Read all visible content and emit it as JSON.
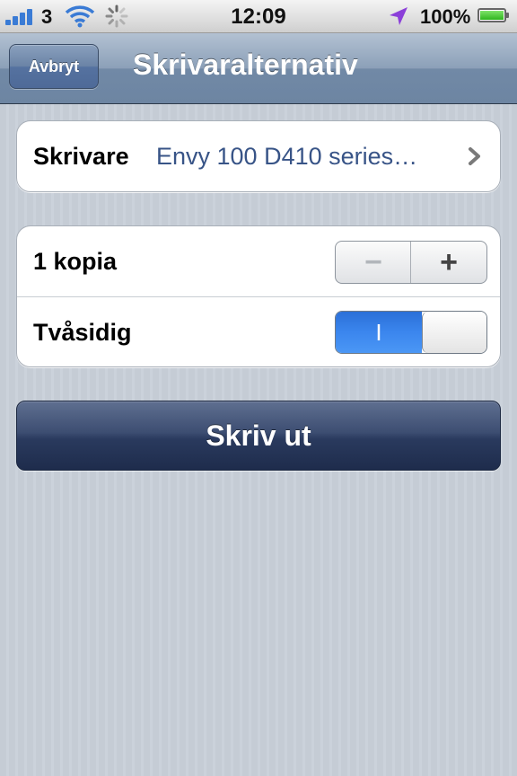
{
  "status_bar": {
    "carrier": "3",
    "time": "12:09",
    "battery": "100%",
    "battery_level": 1.0
  },
  "nav": {
    "cancel_label": "Avbryt",
    "title": "Skrivaralternativ"
  },
  "printer": {
    "label": "Skrivare",
    "value": "Envy 100 D410 series…"
  },
  "copies": {
    "label": "1 kopia",
    "minus": "−",
    "plus": "+"
  },
  "duplex": {
    "label": "Tvåsidig",
    "on_symbol": "I",
    "state": "on"
  },
  "print_button": "Skriv ut",
  "icons": [
    "signal-icon",
    "wifi-icon",
    "activity-spinner-icon",
    "location-arrow-icon",
    "battery-icon",
    "chevron-right-icon"
  ],
  "colors": {
    "accent_blue": "#3b86ee",
    "value_text": "#385487",
    "location_arrow": "#8b3fd9",
    "battery_green": "#2fb51e"
  }
}
